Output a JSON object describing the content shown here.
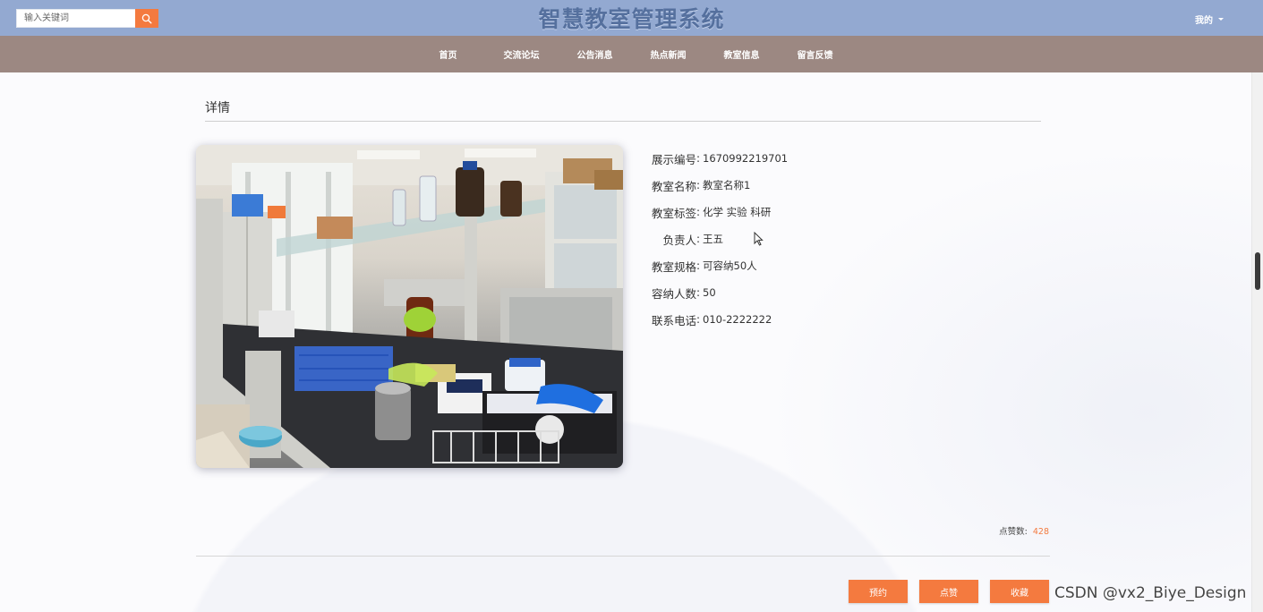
{
  "header": {
    "search_placeholder": "输入关键词",
    "site_title": "智慧教室管理系统",
    "user_menu_label": "我的"
  },
  "nav": {
    "items": [
      "首页",
      "交流论坛",
      "公告消息",
      "热点新闻",
      "教室信息",
      "留言反馈"
    ]
  },
  "detail": {
    "heading": "详情",
    "fields": [
      {
        "label": "展示编号",
        "value": "1670992219701"
      },
      {
        "label": "教室名称",
        "value": "教室名称1"
      },
      {
        "label": "教室标签",
        "value": "化学 实验 科研"
      },
      {
        "label": "负责人",
        "value": "王五"
      },
      {
        "label": "教室规格",
        "value": "可容纳50人"
      },
      {
        "label": "容纳人数",
        "value": "50"
      },
      {
        "label": "联系电话",
        "value": "010-2222222"
      }
    ],
    "colon": ":",
    "likes_label": "点赞数:",
    "likes_count": "428"
  },
  "actions": {
    "reserve_label": "预约",
    "like_label": "点赞",
    "favorite_label": "收藏"
  },
  "watermark": "CSDN @vx2_Biye_Design",
  "colors": {
    "topbar": "#93a9d1",
    "navbar": "#9c8882",
    "accent": "#f47a3f"
  }
}
